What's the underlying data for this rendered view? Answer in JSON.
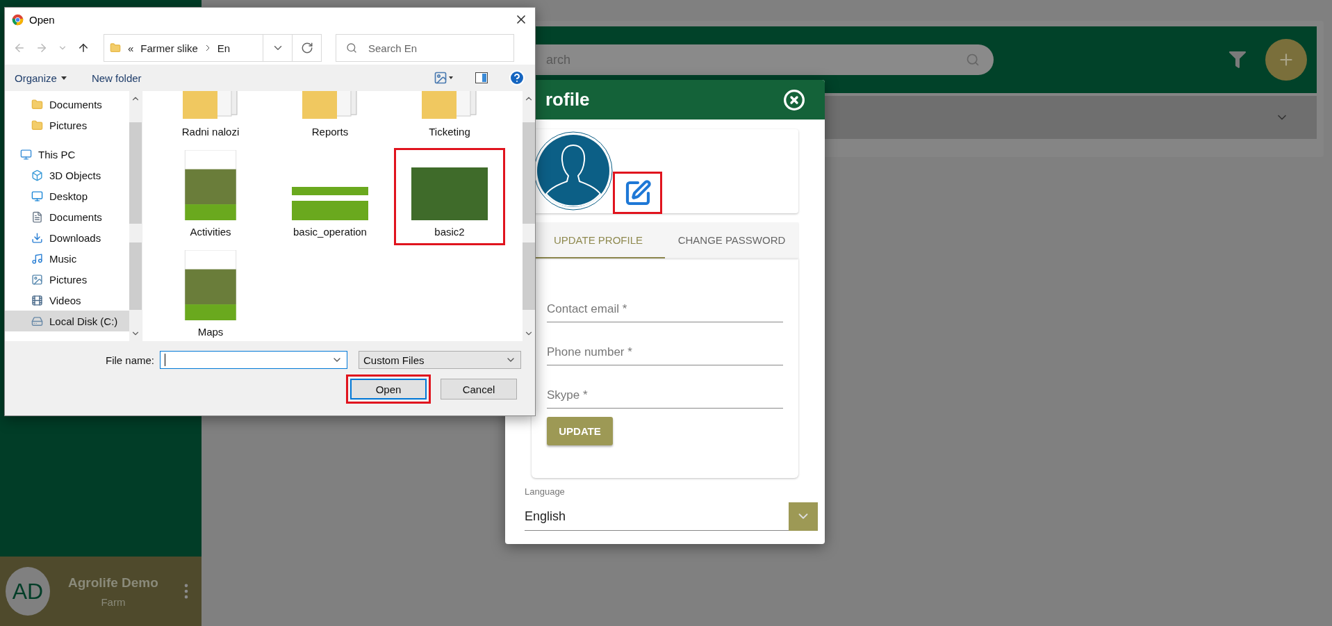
{
  "app": {
    "header": {
      "search_placeholder": "arch"
    },
    "sidebar_user": {
      "initials": "AD",
      "name": "Agrolife Demo",
      "role": "Farm"
    }
  },
  "profile": {
    "title": "rofile",
    "edit_photo": {
      "highlighted": true
    },
    "tabs": [
      {
        "label": "UPDATE PROFILE",
        "selected": true
      },
      {
        "label": "CHANGE PASSWORD",
        "selected": false
      }
    ],
    "fields": [
      {
        "placeholder": "Contact email *"
      },
      {
        "placeholder": "Phone number *"
      },
      {
        "placeholder": "Skype *"
      }
    ],
    "button": "UPDATE",
    "language": {
      "label": "Language",
      "value": "English"
    }
  },
  "dialog": {
    "title": "Open",
    "path_overflow": "«",
    "path": [
      "Farmer slike",
      "En"
    ],
    "search_placeholder": "Search En",
    "toolbar": [
      {
        "label": "Organize",
        "kind": "menu"
      },
      {
        "label": "New folder",
        "kind": "button"
      }
    ],
    "quick_access": [
      {
        "label": "Documents",
        "kind": "folder",
        "selected": false
      },
      {
        "label": "Pictures",
        "kind": "folder",
        "selected": false
      }
    ],
    "this_pc": {
      "label": "This PC",
      "kind": "pc",
      "selected": false,
      "children": [
        {
          "label": "3D Objects",
          "kind": "cube",
          "selected": false
        },
        {
          "label": "Desktop",
          "kind": "desktop",
          "selected": false
        },
        {
          "label": "Documents",
          "kind": "documents",
          "selected": false
        },
        {
          "label": "Downloads",
          "kind": "downloads",
          "selected": false
        },
        {
          "label": "Music",
          "kind": "music",
          "selected": false
        },
        {
          "label": "Pictures",
          "kind": "pictures",
          "selected": false
        },
        {
          "label": "Videos",
          "kind": "videos",
          "selected": false
        },
        {
          "label": "Local Disk (C:)",
          "kind": "disk",
          "selected": true
        }
      ]
    },
    "files": [
      {
        "name": "Radni nalozi",
        "kind": "folder",
        "highlighted": false
      },
      {
        "name": "Reports",
        "kind": "folder",
        "highlighted": false
      },
      {
        "name": "Ticketing",
        "kind": "folder",
        "highlighted": false
      },
      {
        "name": "Activities",
        "kind": "document",
        "highlighted": false
      },
      {
        "name": "basic_operation",
        "kind": "slide",
        "highlighted": false
      },
      {
        "name": "basic2",
        "kind": "photo",
        "highlighted": true
      },
      {
        "name": "Maps",
        "kind": "document",
        "highlighted": false
      }
    ],
    "file_name_label": "File name:",
    "filter": "Custom Files",
    "buttons": [
      {
        "label": "Open",
        "focused": true,
        "highlighted": true
      },
      {
        "label": "Cancel",
        "focused": false,
        "highlighted": false
      }
    ]
  }
}
